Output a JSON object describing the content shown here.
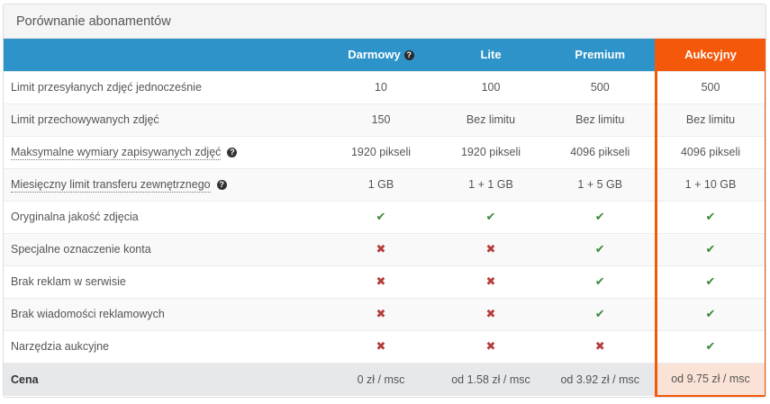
{
  "panel": {
    "title": "Porównanie abonamentów"
  },
  "plans": [
    {
      "name": "Darmowy",
      "has_help": true
    },
    {
      "name": "Lite",
      "has_help": false
    },
    {
      "name": "Premium",
      "has_help": false
    },
    {
      "name": "Aukcyjny",
      "has_help": false,
      "highlighted": true
    }
  ],
  "colors": {
    "header_blue": "#2d93c8",
    "highlight_orange": "#f4580b",
    "check_green": "#3a8a3a",
    "cross_red": "#b53b3b"
  },
  "icons": {
    "help": "question-circle-icon",
    "check": "check-icon",
    "cross": "cross-icon"
  },
  "help_glyph": "?",
  "rows": [
    {
      "label": "Limit przesyłanych zdjęć jednocześnie",
      "dotted": false,
      "help": false,
      "cells": [
        "10",
        "100",
        "500",
        "500"
      ]
    },
    {
      "label": "Limit przechowywanych zdjęć",
      "dotted": false,
      "help": false,
      "cells": [
        "150",
        "Bez limitu",
        "Bez limitu",
        "Bez limitu"
      ]
    },
    {
      "label": "Maksymalne wymiary zapisywanych zdjęć",
      "dotted": true,
      "help": true,
      "cells": [
        "1920 pikseli",
        "1920 pikseli",
        "4096 pikseli",
        "4096 pikseli"
      ]
    },
    {
      "label": "Miesięczny limit transferu zewnętrznego",
      "dotted": true,
      "help": true,
      "cells": [
        "1 GB",
        "1 + 1 GB",
        "1 + 5 GB",
        "1 + 10 GB"
      ]
    },
    {
      "label": "Oryginalna jakość zdjęcia",
      "dotted": false,
      "help": false,
      "cells": [
        "check",
        "check",
        "check",
        "check"
      ]
    },
    {
      "label": "Specjalne oznaczenie konta",
      "dotted": false,
      "help": false,
      "cells": [
        "cross",
        "cross",
        "check",
        "check"
      ]
    },
    {
      "label": "Brak reklam w serwisie",
      "dotted": false,
      "help": false,
      "cells": [
        "cross",
        "cross",
        "check",
        "check"
      ]
    },
    {
      "label": "Brak wiadomości reklamowych",
      "dotted": false,
      "help": false,
      "cells": [
        "cross",
        "cross",
        "check",
        "check"
      ]
    },
    {
      "label": "Narzędzia aukcyjne",
      "dotted": false,
      "help": false,
      "cells": [
        "cross",
        "cross",
        "cross",
        "check"
      ]
    }
  ],
  "price_row": {
    "label": "Cena",
    "cells": [
      "0 zł / msc",
      "od 1.58 zł / msc",
      "od 3.92 zł / msc",
      "od 9.75 zł / msc"
    ]
  }
}
